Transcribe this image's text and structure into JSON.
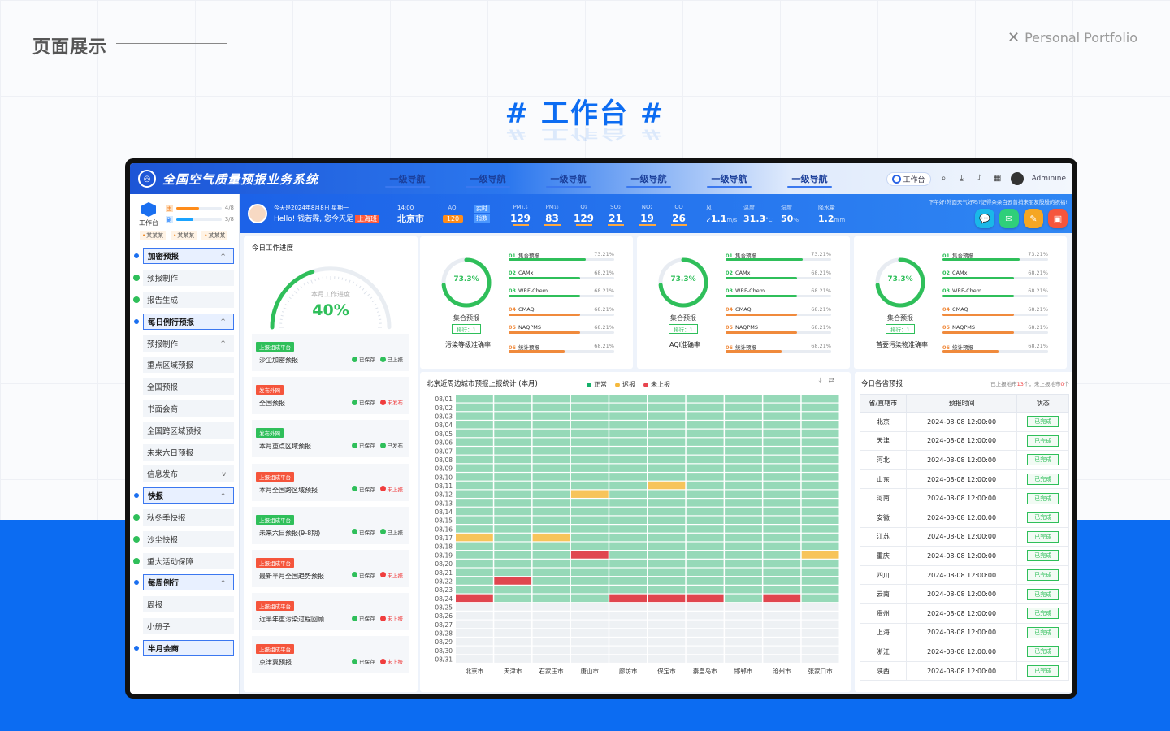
{
  "page": {
    "section_title": "页面展示",
    "portfolio_label": "Personal Portfolio",
    "hero_title": "# 工作台 #"
  },
  "app": {
    "title": "全国空气质量预报业务系统",
    "nav": [
      "一级导航",
      "一级导航",
      "一级导航",
      "一级导航",
      "一级导航",
      "一级导航"
    ],
    "workspace_label": "工作台",
    "user": "Adminine"
  },
  "sidebar": {
    "ws_label": "工作台",
    "progress": [
      {
        "tag": "主",
        "text": "4/8",
        "fraction": 0.5,
        "color": "#ff8c1a"
      },
      {
        "tag": "副",
        "text": "3/8",
        "fraction": 0.375,
        "color": "#1aa3ff"
      }
    ],
    "chips": [
      "某某某",
      "某某某",
      "某某某"
    ],
    "items": [
      {
        "label": "加密预报",
        "type": "grp",
        "mark": "dot",
        "caret": "^"
      },
      {
        "label": "预报制作",
        "type": "item",
        "mark": "chk"
      },
      {
        "label": "报告生成",
        "type": "item",
        "mark": "chk"
      },
      {
        "label": "每日例行预报",
        "type": "grp",
        "mark": "dot",
        "caret": "^"
      },
      {
        "label": "预报制作",
        "type": "item",
        "mark": "none",
        "caret": "^"
      },
      {
        "label": "重点区域预报",
        "type": "sub",
        "mark": "none"
      },
      {
        "label": "全国预报",
        "type": "sub",
        "mark": "none"
      },
      {
        "label": "书面会商",
        "type": "sub",
        "mark": "none"
      },
      {
        "label": "全国跨区域预报",
        "type": "sub",
        "mark": "none"
      },
      {
        "label": "未来六日预报",
        "type": "sub",
        "mark": "none"
      },
      {
        "label": "信息发布",
        "type": "item",
        "mark": "none",
        "caret": "v"
      },
      {
        "label": "快报",
        "type": "grp",
        "mark": "dot",
        "caret": "^"
      },
      {
        "label": "秋冬季快报",
        "type": "item",
        "mark": "chk"
      },
      {
        "label": "沙尘快报",
        "type": "item",
        "mark": "chk"
      },
      {
        "label": "重大活动保障",
        "type": "item",
        "mark": "chk"
      },
      {
        "label": "每周例行",
        "type": "grp",
        "mark": "dot",
        "caret": "^"
      },
      {
        "label": "周报",
        "type": "item",
        "mark": "none"
      },
      {
        "label": "小册子",
        "type": "item",
        "mark": "none"
      },
      {
        "label": "半月会商",
        "type": "grp",
        "mark": "dot"
      }
    ]
  },
  "header": {
    "date_line": "今天是2024年8月8日 星期一",
    "greeting": "Hello! 钱若霖, 您今天是",
    "duty_city": "上海班",
    "time": "14:00",
    "city": "北京市",
    "aqi_label": "AQI",
    "aqi_value": "120",
    "rt_tags": [
      "实时",
      "指数"
    ],
    "metrics": [
      {
        "label": "PM₂.₅",
        "value": "129"
      },
      {
        "label": "PM₁₀",
        "value": "83"
      },
      {
        "label": "O₃",
        "value": "129"
      },
      {
        "label": "SO₂",
        "value": "21"
      },
      {
        "label": "NO₂",
        "value": "19"
      },
      {
        "label": "CO",
        "value": "26"
      }
    ],
    "weather": [
      {
        "label": "风",
        "value": "1.1",
        "unit": "m/s",
        "prefix": "↙"
      },
      {
        "label": "温度",
        "value": "31.3",
        "unit": "°C"
      },
      {
        "label": "湿度",
        "value": "50",
        "unit": "%"
      },
      {
        "label": "降水量",
        "value": "1.2",
        "unit": "mm"
      }
    ],
    "notice": "下午好!外面天气好吗?记得朵朵白云曾捎来朋友殷殷的祝福!",
    "actions": [
      {
        "icon": "chat-icon",
        "color": "#1ab8e8",
        "glyph": "💬"
      },
      {
        "icon": "mail-icon",
        "color": "#2fcf7a",
        "glyph": "✉"
      },
      {
        "icon": "edit-icon",
        "color": "#f5a623",
        "glyph": "✎"
      },
      {
        "icon": "folder-icon",
        "color": "#f5553c",
        "glyph": "▣"
      }
    ]
  },
  "progress_card": {
    "title": "今日工作进度",
    "gauge_label": "本月工作进度",
    "gauge_value": "40%",
    "gauge_fraction": 0.4,
    "tasks": [
      {
        "tag": "上报组成平台",
        "tag_color": "#2fbf5a",
        "name": "沙尘加密预报",
        "s1": "已保存",
        "s1ok": true,
        "s2": "已上报",
        "s2ok": true
      },
      {
        "tag": "发布外网",
        "tag_color": "#f5553c",
        "name": "全国预报",
        "s1": "已保存",
        "s1ok": true,
        "s2": "未发布",
        "s2ok": false
      },
      {
        "tag": "发布外网",
        "tag_color": "#2fbf5a",
        "name": "本月重点区域预报",
        "s1": "已保存",
        "s1ok": true,
        "s2": "已发布",
        "s2ok": true
      },
      {
        "tag": "上报组成平台",
        "tag_color": "#f5553c",
        "name": "本月全国跨区域预报",
        "s1": "已保存",
        "s1ok": true,
        "s2": "未上报",
        "s2ok": false
      },
      {
        "tag": "上报组成平台",
        "tag_color": "#2fbf5a",
        "name": "未来六日预报(9-8期)",
        "s1": "已保存",
        "s1ok": true,
        "s2": "已上报",
        "s2ok": true
      },
      {
        "tag": "上报组成平台",
        "tag_color": "#f5553c",
        "name": "最新半月全国趋势预报",
        "s1": "已保存",
        "s1ok": true,
        "s2": "未上报",
        "s2ok": false
      },
      {
        "tag": "上报组成平台",
        "tag_color": "#f5553c",
        "name": "近半年重污染过程回顾",
        "s1": "已保存",
        "s1ok": true,
        "s2": "未上报",
        "s2ok": false
      },
      {
        "tag": "上报组成平台",
        "tag_color": "#f5553c",
        "name": "京津冀预报",
        "s1": "已保存",
        "s1ok": true,
        "s2": "未上报",
        "s2ok": false
      }
    ]
  },
  "accuracy_cards": [
    {
      "ring_value": "73.3%",
      "ring_fraction": 0.733,
      "ring_name": "集合预报",
      "rank": "排行：1",
      "title": "污染等级准确率",
      "models": [
        {
          "no": "01",
          "name": "集合预报",
          "pct": "73.21%",
          "fraction": 0.73,
          "color": "#2fbf5a"
        },
        {
          "no": "02",
          "name": "CAMx",
          "pct": "68.21%",
          "fraction": 0.68,
          "color": "#2fbf5a"
        },
        {
          "no": "03",
          "name": "WRF-Chem",
          "pct": "68.21%",
          "fraction": 0.68,
          "color": "#2fbf5a"
        },
        {
          "no": "04",
          "name": "CMAQ",
          "pct": "68.21%",
          "fraction": 0.68,
          "color": "#f08a3c"
        },
        {
          "no": "05",
          "name": "NAQPMS",
          "pct": "68.21%",
          "fraction": 0.68,
          "color": "#f08a3c"
        },
        {
          "no": "06",
          "name": "统计预报",
          "pct": "68.21%",
          "fraction": 0.53,
          "color": "#f08a3c"
        }
      ]
    },
    {
      "ring_value": "73.3%",
      "ring_fraction": 0.733,
      "ring_name": "集合预报",
      "rank": "排行：1",
      "title": "AQI准确率",
      "models": [
        {
          "no": "01",
          "name": "集合预报",
          "pct": "73.21%",
          "fraction": 0.73,
          "color": "#2fbf5a"
        },
        {
          "no": "02",
          "name": "CAMx",
          "pct": "68.21%",
          "fraction": 0.68,
          "color": "#2fbf5a"
        },
        {
          "no": "03",
          "name": "WRF-Chem",
          "pct": "68.21%",
          "fraction": 0.68,
          "color": "#2fbf5a"
        },
        {
          "no": "04",
          "name": "CMAQ",
          "pct": "68.21%",
          "fraction": 0.68,
          "color": "#f08a3c"
        },
        {
          "no": "05",
          "name": "NAQPMS",
          "pct": "68.21%",
          "fraction": 0.68,
          "color": "#f08a3c"
        },
        {
          "no": "06",
          "name": "统计预报",
          "pct": "68.21%",
          "fraction": 0.53,
          "color": "#f08a3c"
        }
      ]
    },
    {
      "ring_value": "73.3%",
      "ring_fraction": 0.733,
      "ring_name": "集合预报",
      "rank": "排行：1",
      "title": "首要污染物准确率",
      "models": [
        {
          "no": "01",
          "name": "集合预报",
          "pct": "73.21%",
          "fraction": 0.73,
          "color": "#2fbf5a"
        },
        {
          "no": "02",
          "name": "CAMx",
          "pct": "68.21%",
          "fraction": 0.68,
          "color": "#2fbf5a"
        },
        {
          "no": "03",
          "name": "WRF-Chem",
          "pct": "68.21%",
          "fraction": 0.68,
          "color": "#2fbf5a"
        },
        {
          "no": "04",
          "name": "CMAQ",
          "pct": "68.21%",
          "fraction": 0.68,
          "color": "#f08a3c"
        },
        {
          "no": "05",
          "name": "NAQPMS",
          "pct": "68.21%",
          "fraction": 0.68,
          "color": "#f08a3c"
        },
        {
          "no": "06",
          "name": "统计预报",
          "pct": "68.21%",
          "fraction": 0.53,
          "color": "#f08a3c"
        }
      ]
    }
  ],
  "heatmap": {
    "title": "北京近周边城市预报上报统计 (本月)",
    "legend": [
      {
        "label": "正常",
        "color": "#14b06a"
      },
      {
        "label": "迟报",
        "color": "#f5b93c"
      },
      {
        "label": "未上报",
        "color": "#e8454f"
      }
    ],
    "cities": [
      "北京市",
      "天津市",
      "石家庄市",
      "唐山市",
      "廊坊市",
      "保定市",
      "秦皇岛市",
      "邯郸市",
      "沧州市",
      "张家口市"
    ],
    "dates": [
      "08/01",
      "08/02",
      "08/03",
      "08/04",
      "08/05",
      "08/06",
      "08/07",
      "08/08",
      "08/09",
      "08/10",
      "08/11",
      "08/12",
      "08/13",
      "08/14",
      "08/15",
      "08/16",
      "08/17",
      "08/18",
      "08/19",
      "08/20",
      "08/21",
      "08/22",
      "08/23",
      "08/24",
      "08/25",
      "08/26",
      "08/27",
      "08/28",
      "08/29",
      "08/30",
      "08/31"
    ],
    "reported_days": 24,
    "cells_color": {
      "normal": "#96d9b8",
      "late": "#f7c45a",
      "missing": "#e0464f",
      "empty": "#eef1f4"
    },
    "exceptions": [
      {
        "date": "08/11",
        "city": "保定市",
        "status": "late"
      },
      {
        "date": "08/12",
        "city": "唐山市",
        "status": "late"
      },
      {
        "date": "08/17",
        "city": "北京市",
        "status": "late"
      },
      {
        "date": "08/17",
        "city": "石家庄市",
        "status": "late"
      },
      {
        "date": "08/19",
        "city": "唐山市",
        "status": "missing"
      },
      {
        "date": "08/19",
        "city": "张家口市",
        "status": "late"
      },
      {
        "date": "08/22",
        "city": "天津市",
        "status": "missing"
      },
      {
        "date": "08/24",
        "city": "北京市",
        "status": "missing"
      },
      {
        "date": "08/24",
        "city": "廊坊市",
        "status": "missing"
      },
      {
        "date": "08/24",
        "city": "保定市",
        "status": "missing"
      },
      {
        "date": "08/24",
        "city": "秦皇岛市",
        "status": "missing"
      },
      {
        "date": "08/24",
        "city": "沧州市",
        "status": "missing"
      }
    ]
  },
  "province_table": {
    "title": "今日各省预报",
    "summary_prefix": "已上报地市",
    "reported": "13",
    "summary_mid": "个，未上报地市",
    "unreported": "0",
    "summary_suffix": "个",
    "columns": [
      "省/直辖市",
      "预报时间",
      "状态"
    ],
    "rows": [
      [
        "北京",
        "2024-08-08 12:00:00",
        "已完成"
      ],
      [
        "天津",
        "2024-08-08 12:00:00",
        "已完成"
      ],
      [
        "河北",
        "2024-08-08 12:00:00",
        "已完成"
      ],
      [
        "山东",
        "2024-08-08 12:00:00",
        "已完成"
      ],
      [
        "河南",
        "2024-08-08 12:00:00",
        "已完成"
      ],
      [
        "安徽",
        "2024-08-08 12:00:00",
        "已完成"
      ],
      [
        "江苏",
        "2024-08-08 12:00:00",
        "已完成"
      ],
      [
        "重庆",
        "2024-08-08 12:00:00",
        "已完成"
      ],
      [
        "四川",
        "2024-08-08 12:00:00",
        "已完成"
      ],
      [
        "云南",
        "2024-08-08 12:00:00",
        "已完成"
      ],
      [
        "贵州",
        "2024-08-08 12:00:00",
        "已完成"
      ],
      [
        "上海",
        "2024-08-08 12:00:00",
        "已完成"
      ],
      [
        "浙江",
        "2024-08-08 12:00:00",
        "已完成"
      ],
      [
        "陕西",
        "2024-08-08 12:00:00",
        "已完成"
      ]
    ]
  }
}
